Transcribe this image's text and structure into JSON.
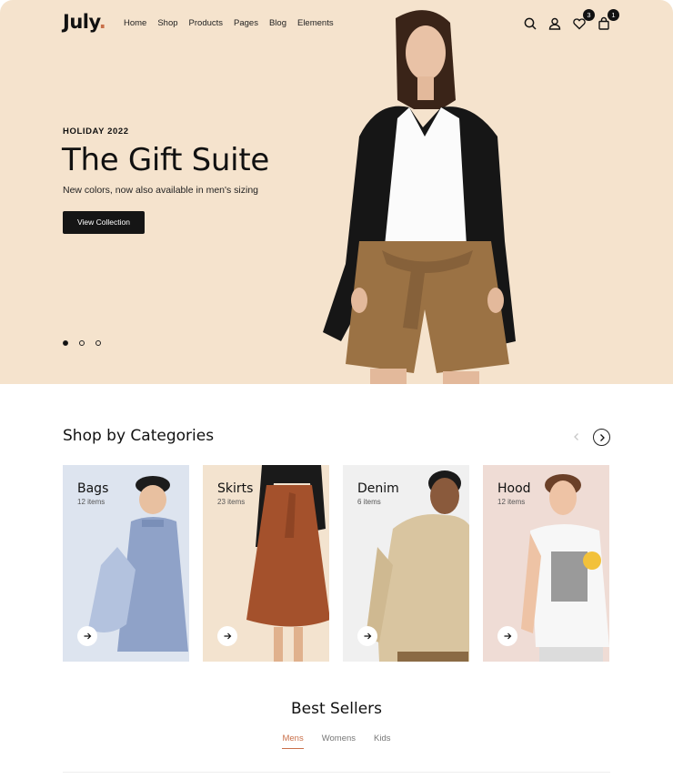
{
  "header": {
    "logo": "July",
    "logo_dot": ".",
    "nav": [
      "Home",
      "Shop",
      "Products",
      "Pages",
      "Blog",
      "Elements"
    ],
    "wishlist_count": "3",
    "cart_count": "1"
  },
  "hero": {
    "eyebrow": "HOLIDAY 2022",
    "title": "The Gift Suite",
    "subtitle": "New colors, now also available in men's sizing",
    "cta": "View Collection",
    "bg_color": "#f5e3cd"
  },
  "categories": {
    "title": "Shop by Categories",
    "items": [
      {
        "name": "Bags",
        "count": "12 items",
        "bg": "#dde4ef"
      },
      {
        "name": "Skirts",
        "count": "23 items",
        "bg": "#f3e3cf"
      },
      {
        "name": "Denim",
        "count": "6 items",
        "bg": "#f0f0f0"
      },
      {
        "name": "Hood",
        "count": "12 items",
        "bg": "#efdcd5"
      }
    ]
  },
  "best_sellers": {
    "title": "Best Sellers",
    "tabs": [
      "Mens",
      "Womens",
      "Kids"
    ],
    "active_tab": "Mens",
    "accent": "#c9704a"
  }
}
